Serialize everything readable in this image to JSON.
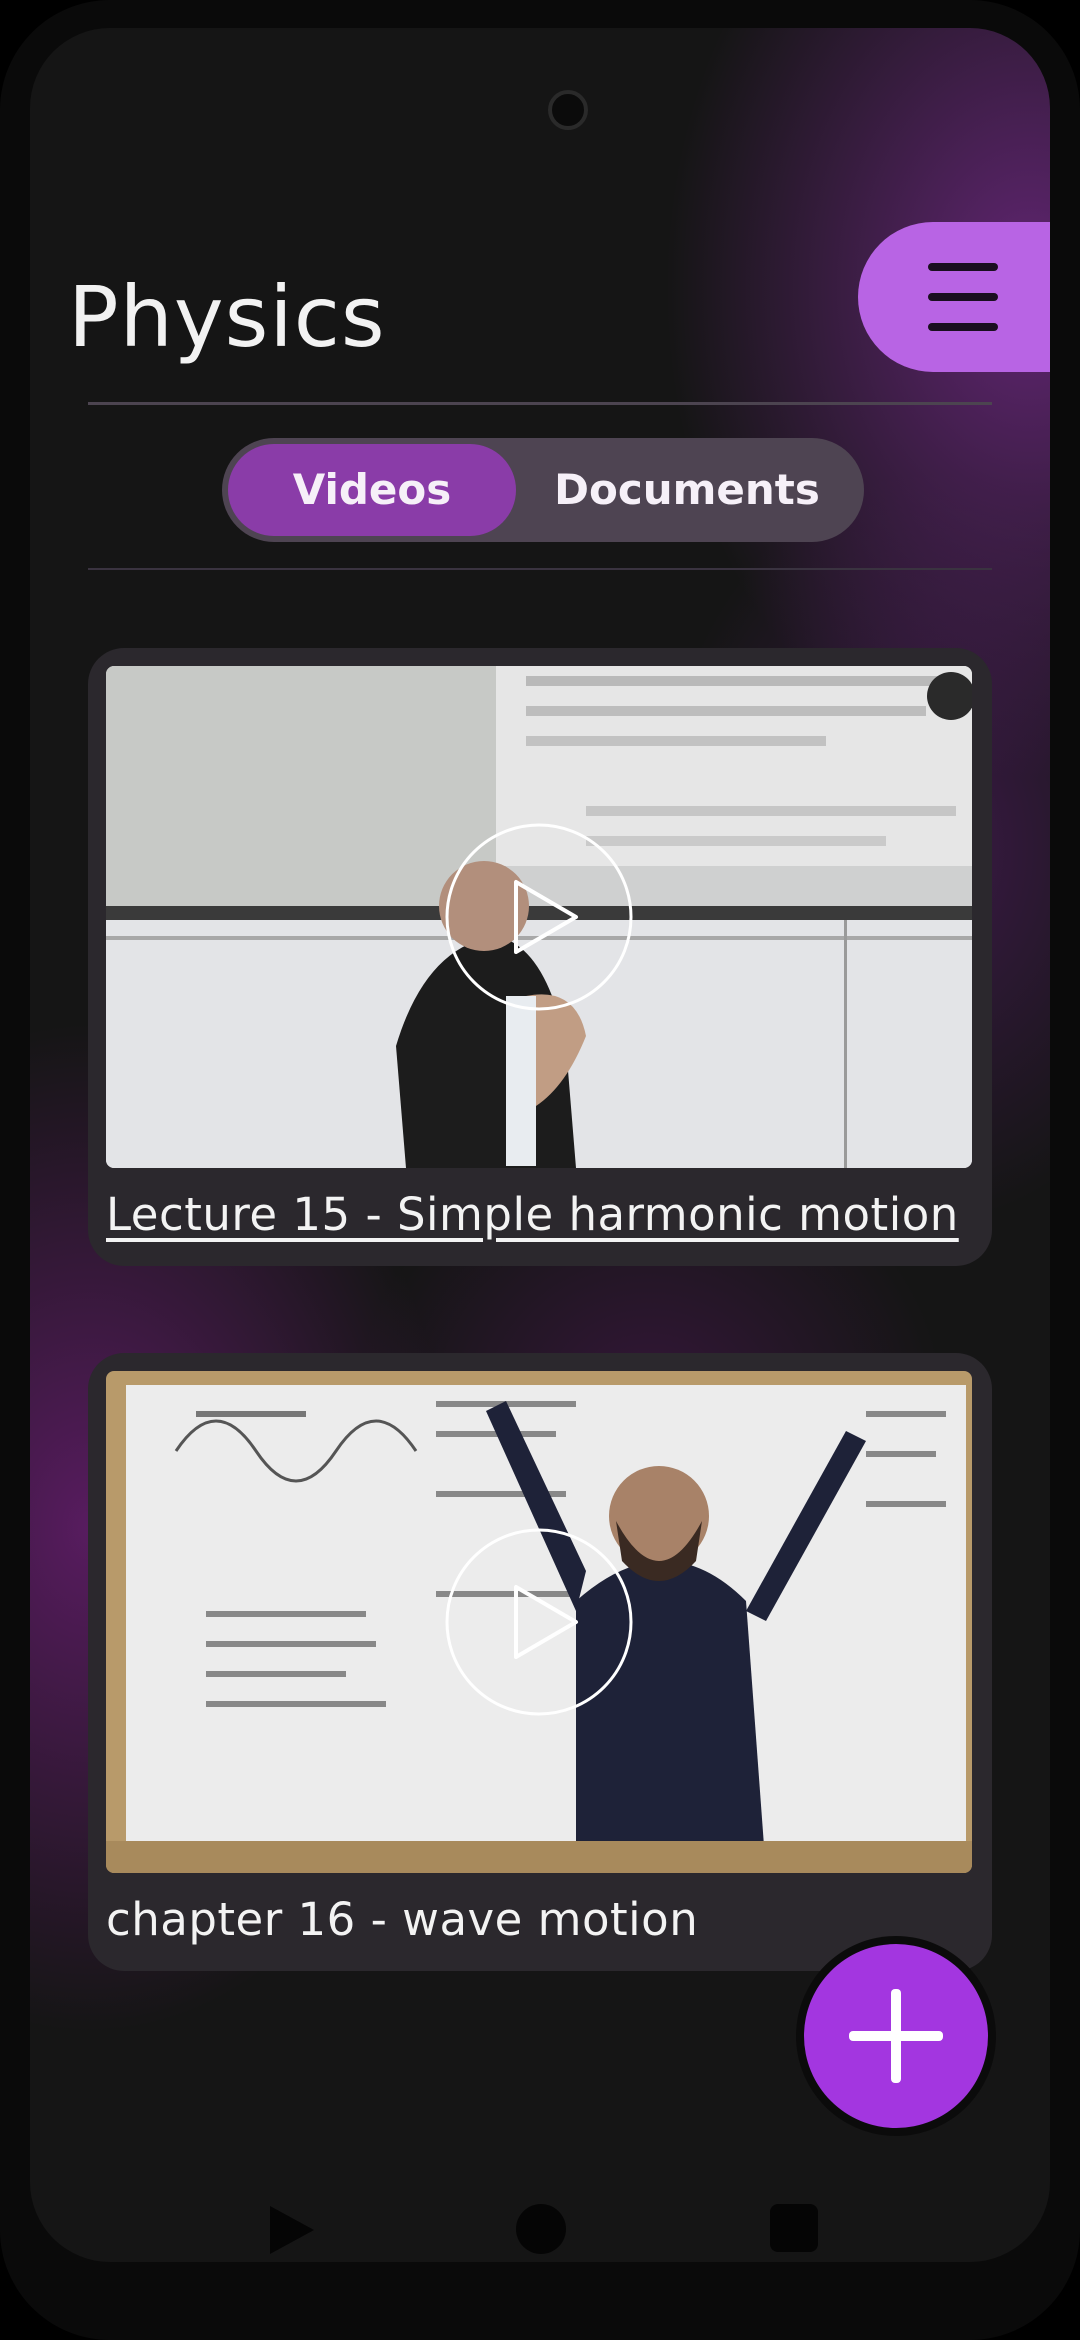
{
  "header": {
    "title": "Physics",
    "menu_icon": "hamburger-menu-icon"
  },
  "tabs": [
    {
      "label": "Videos",
      "selected": true
    },
    {
      "label": "Documents",
      "selected": false
    }
  ],
  "videos": [
    {
      "title": "Lecture 15 - Simple harmonic motion",
      "play_icon": "play-icon"
    },
    {
      "title": "chapter 16 - wave motion",
      "play_icon": "play-icon"
    }
  ],
  "fab": {
    "icon": "plus-icon"
  },
  "nav_bar": {
    "icons": [
      "back-triangle-icon",
      "home-circle-icon",
      "recents-square-icon"
    ]
  },
  "colors": {
    "accent": "#b864e4",
    "tab_selected": "#8a3ca8",
    "fab": "#a336e0",
    "background": "#151515"
  }
}
